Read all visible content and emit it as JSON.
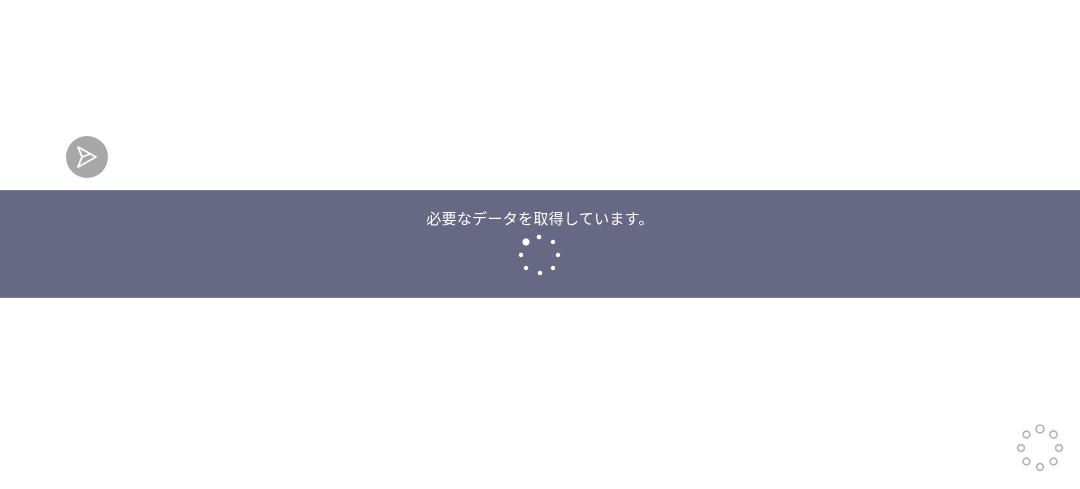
{
  "loading": {
    "message": "必要なデータを取得しています。"
  },
  "icons": {
    "logo": "send-arrow-icon",
    "banner_spinner": "loading-spinner-icon",
    "corner_spinner": "loading-ring-icon"
  },
  "colors": {
    "banner_background": "#676883",
    "logo_background": "#a8a8ab",
    "spinner_dots": "#ffffff",
    "corner_spinner_stroke": "#b4b4b8"
  }
}
